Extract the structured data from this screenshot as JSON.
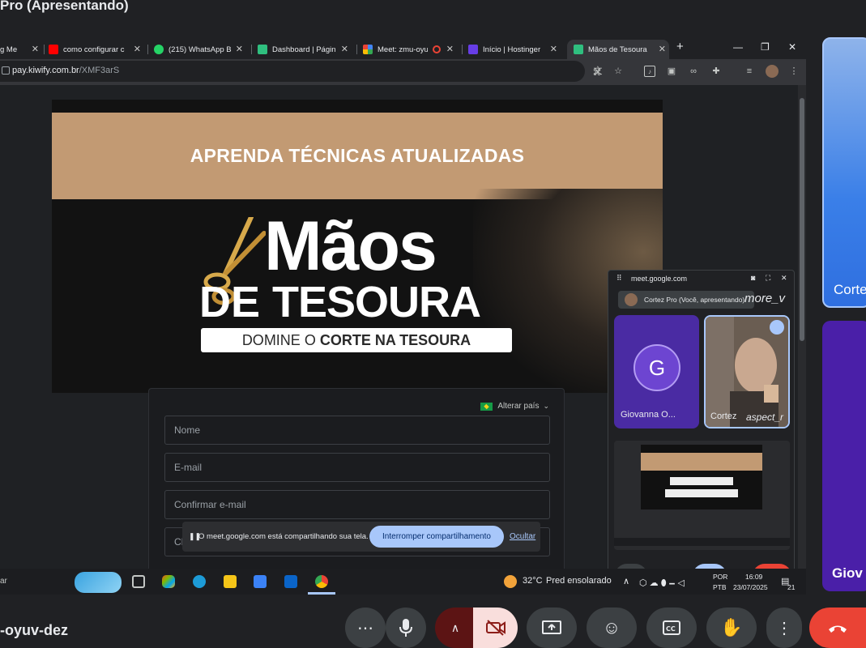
{
  "meet": {
    "presenting_title": "Pro (Apresentando)",
    "meeting_code": "-oyuv-dez",
    "colors": {
      "end_call": "#ea4335",
      "camera_off": "#f9dedc",
      "accent": "#a8c7fa"
    }
  },
  "browser": {
    "tabs": [
      {
        "label": "g Me",
        "icon": "meet-icon"
      },
      {
        "label": "como configurar c",
        "icon": "youtube-icon"
      },
      {
        "label": "(215) WhatsApp B",
        "icon": "whatsapp-icon"
      },
      {
        "label": "Dashboard | Págin",
        "icon": "kiwify-icon"
      },
      {
        "label": "Meet: zmu-oyu",
        "icon": "meet-icon"
      },
      {
        "label": "Início | Hostinger",
        "icon": "hostinger-icon"
      },
      {
        "label": "Mãos de Tesoura",
        "icon": "kiwify-icon",
        "active": true
      }
    ],
    "new_tab": "+",
    "url_domain": "pay.kiwify.com.br",
    "url_path": "/XMF3arS"
  },
  "page": {
    "banner_headline": "APRENDA TÉCNICAS ATUALIZADAS",
    "logo_line1": "Mãos",
    "logo_line2_a": "DE",
    "logo_line2_b": "TESOURA",
    "logo_tagline_a": "DOMINE O ",
    "logo_tagline_b": "CORTE NA TESOURA",
    "country_label": "Alterar país",
    "fields": [
      {
        "placeholder": "Nome"
      },
      {
        "placeholder": "E-mail"
      },
      {
        "placeholder": "Confirmar e-mail"
      },
      {
        "placeholder": "CPF"
      }
    ]
  },
  "share_bar": {
    "message": "O meet.google.com está compartilhando sua tela.",
    "stop_button": "Interromper compartilhamento",
    "hide_link": "Ocultar"
  },
  "pip": {
    "title": "meet.google.com",
    "presenter": "Cortez Pro (Você, apresentando)",
    "more_label": "more_v",
    "participant_g_initial": "G",
    "participant_g_name": "Giovanna O...",
    "participant_c_name": "Cortez",
    "participant_c_tag": "aspect_r",
    "controls": [
      "mic",
      "videocam",
      "_",
      "more",
      "call_end"
    ]
  },
  "right_tiles": {
    "tile_a_name": "Corte",
    "tile_b_name": "Giov"
  },
  "taskbar": {
    "search_text": "ar",
    "temperature": "32°C",
    "weather": "Pred ensolarado",
    "lang_top": "POR",
    "lang_bottom": "PTB",
    "time": "16:09",
    "date": "23/07/2025",
    "notifications": "21"
  }
}
